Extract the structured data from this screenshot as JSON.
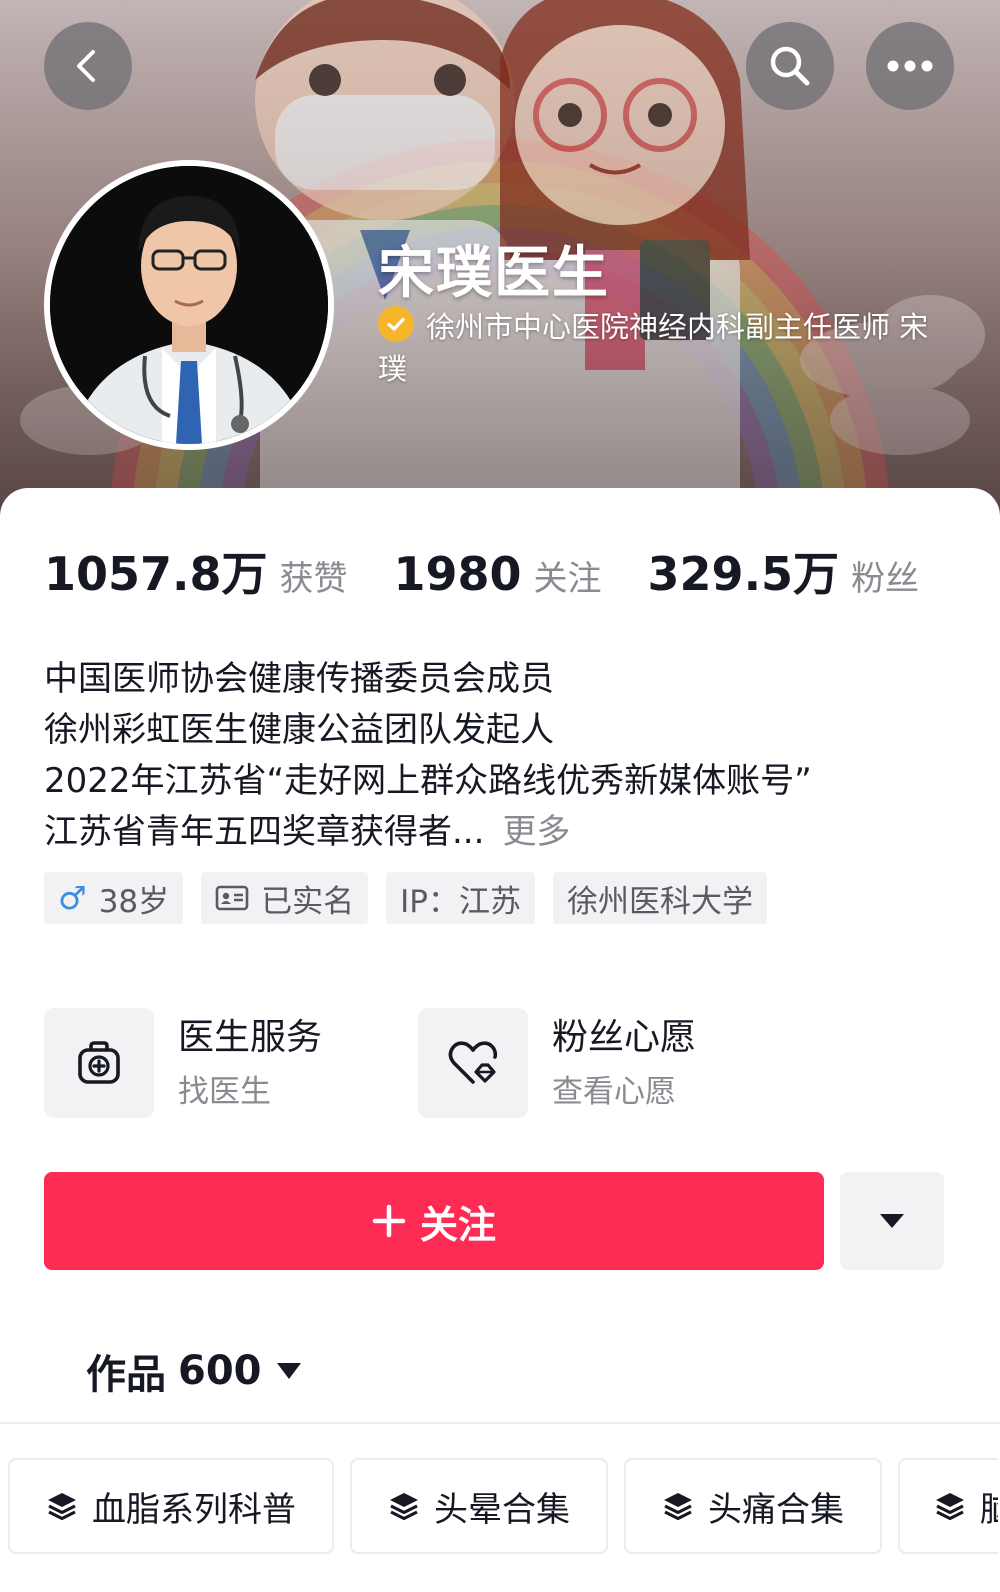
{
  "header": {
    "display_name": "宋璞医生",
    "verification": "徐州市中心医院神经内科副主任医师 宋璞",
    "buttons": [
      "back-icon",
      "search-icon",
      "more-icon"
    ]
  },
  "stats": [
    {
      "value": "1057.8万",
      "label": "获赞"
    },
    {
      "value": "1980",
      "label": "关注"
    },
    {
      "value": "329.5万",
      "label": "粉丝"
    }
  ],
  "bio": {
    "lines": [
      "中国医师协会健康传播委员会成员",
      "徐州彩虹医生健康公益团队发起人",
      "2022年江苏省“走好网上群众路线优秀新媒体账号”",
      "江苏省青年五四奖章获得者..."
    ],
    "more": "更多"
  },
  "tags": {
    "gender_symbol": "♂",
    "age": "38岁",
    "real_name": "已实名",
    "ip": "IP：江苏",
    "school": "徐州医科大学"
  },
  "services": [
    {
      "title": "医生服务",
      "subtitle": "找医生",
      "icon": "medical-kit-icon"
    },
    {
      "title": "粉丝心愿",
      "subtitle": "查看心愿",
      "icon": "heart-wish-icon"
    }
  ],
  "follow": {
    "label": "关注"
  },
  "works": {
    "label": "作品",
    "count": "600"
  },
  "collections": [
    {
      "label": "血脂系列科普"
    },
    {
      "label": "头晕合集"
    },
    {
      "label": "头痛合集"
    },
    {
      "label": "脑"
    }
  ],
  "colors": {
    "accent": "#fe2c55",
    "verify_badge": "#f7b52c",
    "gender_male": "#3b8fe0",
    "muted_text": "#8a8b91",
    "chip_bg": "#f2f2f4"
  }
}
